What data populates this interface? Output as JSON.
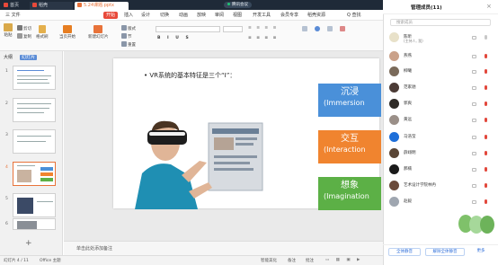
{
  "titlebar": {
    "tabs": [
      "首页",
      "稻壳",
      "5.24课题.pptx"
    ],
    "meeting": "腾讯会议"
  },
  "menubar": {
    "items": [
      "三 文件",
      "开始",
      "插入",
      "设计",
      "切换",
      "动画",
      "放映",
      "审阅",
      "视图",
      "开发工具",
      "会员专享",
      "稻壳资源"
    ],
    "search": "Q 查找"
  },
  "toolbar": {
    "paste": "粘贴",
    "cut": "剪切",
    "copy": "复制",
    "format_painter": "格式刷",
    "play_from_current": "当页开始",
    "new_slide": "新建幻灯片",
    "layout": "版式",
    "section": "节",
    "reset": "重置"
  },
  "left_panel": {
    "tabs": [
      "大纲",
      "幻灯片"
    ],
    "slide_numbers": [
      "1",
      "2",
      "3",
      "4",
      "5",
      "6"
    ]
  },
  "slide": {
    "bullet": "• VR系统的基本特征是三个“I”：",
    "features": [
      {
        "cn": "沉浸",
        "en": "(Immersion",
        "color": "#4a90d9"
      },
      {
        "cn": "交互",
        "en": "(Interaction",
        "color": "#f0842f"
      },
      {
        "cn": "想象",
        "en": "(Imagination",
        "color": "#5cb046"
      }
    ]
  },
  "notes": {
    "placeholder": "单击此处添加备注"
  },
  "statusbar": {
    "slide_info": "幻灯片 4 / 11",
    "theme": "Office 主题",
    "smart_beautify": "智能美化",
    "notes": "备注",
    "comments": "批注"
  },
  "participants_panel": {
    "title": "管理成员(11)",
    "search_placeholder": "搜索成员",
    "members": [
      {
        "name": "陈昕",
        "sub": "(主持人, 我)",
        "avatar_color": "#e8e1c9",
        "mic_on": false
      },
      {
        "name": "燕燕",
        "sub": "",
        "avatar_color": "#caa189",
        "mic_on": true
      },
      {
        "name": "柳曦",
        "sub": "",
        "avatar_color": "#7a6a5a",
        "mic_on": true
      },
      {
        "name": "范家驰",
        "sub": "",
        "avatar_color": "#4b3b35",
        "mic_on": true
      },
      {
        "name": "郭爽",
        "sub": "",
        "avatar_color": "#2e2a26",
        "mic_on": true
      },
      {
        "name": "黄远",
        "sub": "",
        "avatar_color": "#9a8f88",
        "mic_on": true
      },
      {
        "name": "马浩莹",
        "sub": "",
        "avatar_color": "#1e6fd9",
        "mic_on": true
      },
      {
        "name": "薛翊明",
        "sub": "",
        "avatar_color": "#5a4636",
        "mic_on": true
      },
      {
        "name": "郝楠",
        "sub": "",
        "avatar_color": "#1a1a1a",
        "mic_on": true
      },
      {
        "name": "艺术设计学院林冉",
        "sub": "",
        "avatar_color": "#6b4a3a",
        "mic_on": true
      },
      {
        "name": "赵毅",
        "sub": "",
        "avatar_color": "#9fa6b0",
        "mic_on": true
      }
    ],
    "buttons": [
      "全体静音",
      "解除全体静音",
      "更多"
    ]
  },
  "colors": {
    "accent_red": "#e8493a",
    "titlebar_bg": "#1f2a38",
    "meeting_green": "#1ec773"
  }
}
